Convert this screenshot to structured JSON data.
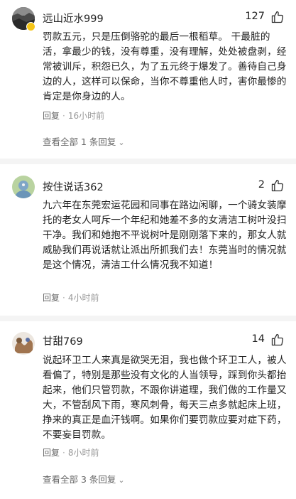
{
  "comments": [
    {
      "username": "远山近水999",
      "likes": "127",
      "avatar_icon": "user-avatar-icon",
      "content": "罚款五元，只是压倒骆驼的最后一根稻草。 干最脏的活，拿最少的钱，没有尊重，没有理解，处处被盘剥，经常被训斥，积怨已久，为了五元终于爆发了。善待自己身边的人，这样可以保命，当你不尊重他人时，害你最惨的肯定是你身边的人。",
      "reply_label": "回复",
      "time": "16小时前",
      "view_all": "查看全部 1 条回复"
    },
    {
      "username": "按住说话362",
      "likes": "2",
      "avatar_icon": "user-avatar-icon",
      "content": "九六年在东莞宏运花园和同事在路边闲聊，一个骑女装摩托的老女人呵斥一个年纪和她差不多的女清洁工树叶没扫干净。我们和她抱不平说树叶是刚刚落下来的，那女人就威胁我们再说话就让派出所抓我们去！东莞当时的情况就是这个情况，清洁工什么情况我不知道！",
      "reply_label": "回复",
      "time": "4小时前"
    },
    {
      "username": "甘甜769",
      "likes": "14",
      "avatar_icon": "user-avatar-icon",
      "content": "说起环卫工人来真是欲哭无泪，我也做个环卫工人，被人看偏了，特别是那些没有文化的人当领导，踩到你头都抬起来，他们只管罚款，不跟你讲道理，我们做的工作量又大，不管刮风下雨，寒风刺骨，每天三点多就起床上班，挣来的真正是血汗钱啊。如果你们要罚款应要对症下药，不要妄目罚款。",
      "reply_label": "回复",
      "time": "8小时前",
      "view_all": "查看全部 3 条回复"
    }
  ],
  "colors": {
    "text": "#222222",
    "meta": "#999999",
    "divider": "#f4f4f4",
    "badge": "#f5c518"
  }
}
